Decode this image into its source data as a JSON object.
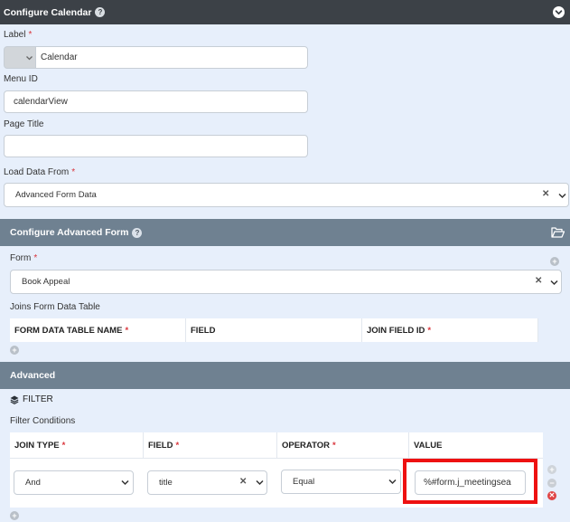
{
  "configure_calendar": {
    "title": "Configure Calendar",
    "help": "?",
    "label_field": {
      "label": "Label",
      "required": "*",
      "value": "Calendar"
    },
    "menu_id_field": {
      "label": "Menu ID",
      "value": "calendarView"
    },
    "page_title_field": {
      "label": "Page Title",
      "value": ""
    },
    "load_data_from": {
      "label": "Load Data From",
      "required": "*",
      "value": "Advanced Form Data",
      "clear": "✕"
    }
  },
  "configure_advanced_form": {
    "title": "Configure Advanced Form",
    "help": "?",
    "form_field": {
      "label": "Form",
      "required": "*",
      "value": "Book Appeal",
      "clear": "✕"
    },
    "joins_label": "Joins Form Data Table",
    "joins_columns": [
      {
        "label": "FORM DATA TABLE NAME",
        "required": "*"
      },
      {
        "label": "FIELD",
        "required": ""
      },
      {
        "label": "JOIN FIELD ID",
        "required": "*"
      }
    ],
    "add_symbol": "+"
  },
  "advanced": {
    "title": "Advanced",
    "filter_label": "FILTER",
    "filter_conditions_label": "Filter Conditions",
    "columns": [
      {
        "label": "JOIN TYPE",
        "required": "*"
      },
      {
        "label": "FIELD",
        "required": "*"
      },
      {
        "label": "OPERATOR",
        "required": "*"
      },
      {
        "label": "VALUE",
        "required": ""
      }
    ],
    "row": {
      "join_type": "And",
      "field": "title",
      "field_clear": "✕",
      "operator": "Equal",
      "value": "%#form.j_meetingsea"
    },
    "add_symbol": "+",
    "remove_symbol": "−",
    "delete_symbol": "✕"
  },
  "colors": {
    "header_dark": "#3c4147",
    "header_slate": "#6f8191",
    "panel_bg": "#e7effb",
    "required": "#d9343b",
    "highlight": "#ee1111"
  },
  "icons": {
    "collapse": "chevron-down-circle-icon",
    "folder": "folder-open-icon",
    "filter": "layers-icon"
  }
}
